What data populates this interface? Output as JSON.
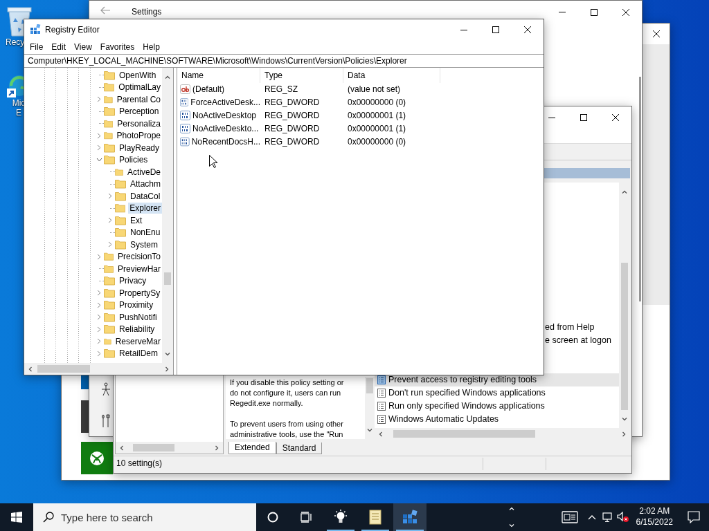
{
  "desktop_icons": [
    {
      "kind": "recycle_bin",
      "label_lines": [
        "Recy"
      ]
    },
    {
      "kind": "browser",
      "label_lines": [
        "Mic",
        "E"
      ]
    }
  ],
  "settings_window": {
    "title": "Settings"
  },
  "group_policy_window": {
    "policy_rows": [
      {
        "kind": "fragment",
        "text": "ed from Help",
        "selected": false
      },
      {
        "kind": "fragment",
        "text": "e screen at logon",
        "selected": false
      },
      {
        "kind": "setting",
        "text": "Prevent access to registry editing tools",
        "selected": true
      },
      {
        "kind": "setting",
        "text": "Don't run specified Windows applications",
        "selected": false
      },
      {
        "kind": "setting",
        "text": "Run only specified Windows applications",
        "selected": false
      },
      {
        "kind": "setting",
        "text": "Windows Automatic Updates",
        "selected": false
      }
    ],
    "description_paragraphs": [
      [
        "If you disable this policy setting or",
        "do not configure it, users can run",
        "Regedit.exe normally."
      ],
      [
        "To prevent users from using other",
        "administrative tools, use the \"Run"
      ]
    ],
    "tabs": [
      {
        "label": "Extended",
        "selected": true
      },
      {
        "label": "Standard",
        "selected": false
      }
    ],
    "status_bar": "10 setting(s)"
  },
  "registry_editor": {
    "title": "Registry Editor",
    "menu": [
      "File",
      "Edit",
      "View",
      "Favorites",
      "Help"
    ],
    "address": "Computer\\HKEY_LOCAL_MACHINE\\SOFTWARE\\Microsoft\\Windows\\CurrentVersion\\Policies\\Explorer",
    "tree": [
      {
        "label": "OpenWith",
        "expandable": false,
        "selected": false
      },
      {
        "label": "OptimalLay",
        "expandable": false,
        "selected": false
      },
      {
        "label": "Parental Co",
        "expandable": true,
        "expanded": false,
        "selected": false
      },
      {
        "label": "Perception",
        "expandable": false,
        "selected": false
      },
      {
        "label": "Personaliza",
        "expandable": false,
        "selected": false
      },
      {
        "label": "PhotoPrope",
        "expandable": true,
        "expanded": false,
        "selected": false
      },
      {
        "label": "PlayReady",
        "expandable": true,
        "expanded": false,
        "selected": false
      },
      {
        "label": "Policies",
        "expandable": true,
        "expanded": true,
        "selected": false,
        "children": [
          {
            "label": "ActiveDe",
            "expandable": false,
            "selected": false
          },
          {
            "label": "Attachm",
            "expandable": false,
            "selected": false
          },
          {
            "label": "DataCol",
            "expandable": true,
            "expanded": false,
            "selected": false
          },
          {
            "label": "Explorer",
            "expandable": false,
            "selected": true
          },
          {
            "label": "Ext",
            "expandable": true,
            "expanded": false,
            "selected": false
          },
          {
            "label": "NonEnu",
            "expandable": false,
            "selected": false
          },
          {
            "label": "System",
            "expandable": true,
            "expanded": false,
            "selected": false
          }
        ]
      },
      {
        "label": "PrecisionTo",
        "expandable": true,
        "expanded": false,
        "selected": false
      },
      {
        "label": "PreviewHar",
        "expandable": false,
        "selected": false
      },
      {
        "label": "Privacy",
        "expandable": false,
        "selected": false
      },
      {
        "label": "PropertySy",
        "expandable": true,
        "expanded": false,
        "selected": false
      },
      {
        "label": "Proximity",
        "expandable": true,
        "expanded": false,
        "selected": false
      },
      {
        "label": "PushNotifi",
        "expandable": true,
        "expanded": false,
        "selected": false
      },
      {
        "label": "Reliability",
        "expandable": true,
        "expanded": false,
        "selected": false
      },
      {
        "label": "ReserveMar",
        "expandable": true,
        "expanded": false,
        "selected": false
      },
      {
        "label": "RetailDem",
        "expandable": true,
        "expanded": false,
        "selected": false
      }
    ],
    "columns": [
      "Name",
      "Type",
      "Data"
    ],
    "values": [
      {
        "kind": "string",
        "name": "(Default)",
        "type": "REG_SZ",
        "data": "(value not set)"
      },
      {
        "kind": "dword",
        "name": "ForceActiveDesk...",
        "type": "REG_DWORD",
        "data": "0x00000000 (0)"
      },
      {
        "kind": "dword",
        "name": "NoActiveDesktop",
        "type": "REG_DWORD",
        "data": "0x00000001 (1)"
      },
      {
        "kind": "dword",
        "name": "NoActiveDeskto...",
        "type": "REG_DWORD",
        "data": "0x00000001 (1)"
      },
      {
        "kind": "dword",
        "name": "NoRecentDocsH...",
        "type": "REG_DWORD",
        "data": "0x00000000 (0)"
      }
    ]
  },
  "taskbar": {
    "search_placeholder": "Type here to search",
    "apps": [
      {
        "kind": "lightbulb",
        "active": false
      },
      {
        "kind": "notepad",
        "active": false
      },
      {
        "kind": "registry",
        "active": true
      }
    ],
    "time": "2:02 AM",
    "date": "6/15/2022"
  }
}
